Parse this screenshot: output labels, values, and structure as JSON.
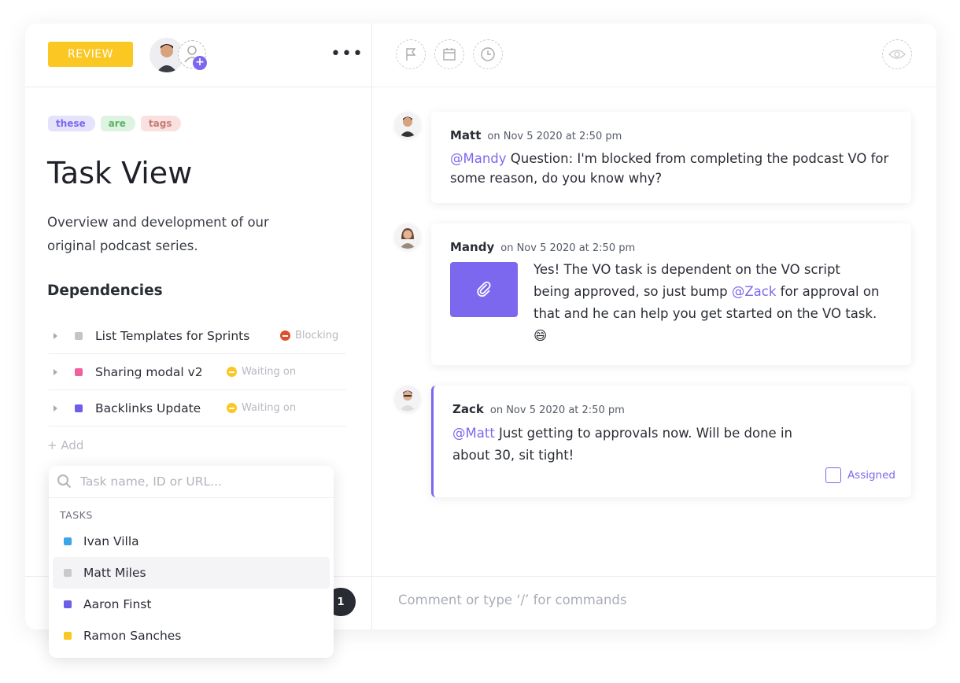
{
  "header": {
    "status": "REVIEW",
    "more_icon": "more-horizontal-icon",
    "toolbar_icons": [
      "flag-icon",
      "calendar-icon",
      "clock-icon"
    ],
    "watch_icon": "eye-icon"
  },
  "tags": [
    {
      "label": "these",
      "bg": "#e5e3fb",
      "fg": "#7b68ee"
    },
    {
      "label": "are",
      "bg": "#dff3e2",
      "fg": "#5db168"
    },
    {
      "label": "tags",
      "bg": "#f9e1df",
      "fg": "#c97a75"
    }
  ],
  "task": {
    "title": "Task View",
    "description": "Overview and development of our original podcast series."
  },
  "dependencies": {
    "heading": "Dependencies",
    "items": [
      {
        "name": "List Templates for Sprints",
        "color": "#c4c4c4",
        "status": "Blocking",
        "status_color": "#e04f2b"
      },
      {
        "name": "Sharing modal v2",
        "color": "#f0609e",
        "status": "Waiting on",
        "status_color": "#fbc723"
      },
      {
        "name": "Backlinks Update",
        "color": "#6e5ee8",
        "status": "Waiting on",
        "status_color": "#fbc723"
      }
    ],
    "add_label": "+ Add"
  },
  "dropdown": {
    "placeholder": "Task name, ID or URL...",
    "heading": "TASKS",
    "items": [
      {
        "name": "Ivan Villa",
        "color": "#3aa6e8"
      },
      {
        "name": "Matt Miles",
        "color": "#c9c9c9"
      },
      {
        "name": "Aaron Finst",
        "color": "#6e5ee8"
      },
      {
        "name": "Ramon Sanches",
        "color": "#fbc723"
      }
    ]
  },
  "badge_count": "1",
  "comments": [
    {
      "author": "Matt",
      "time": "on Nov 5 2020 at 2:50 pm",
      "mention": "@Mandy",
      "text": " Question: I'm blocked from completing the podcast VO for some reason, do you know why?"
    },
    {
      "author": "Mandy",
      "time": "on Nov 5 2020 at 2:50 pm",
      "text_before": "Yes! The VO task is dependent on the VO script being approved, so just bump ",
      "mention": "@Zack",
      "text_after": " for approval on that and he can help you get started on the VO task. 😄",
      "attachment_icon": "paperclip-icon"
    },
    {
      "author": "Zack",
      "time": "on Nov 5 2020 at 2:50 pm",
      "mention": "@Matt",
      "text": " Just getting to approvals now. Will be done in about 30, sit tight!",
      "assigned_label": "Assigned",
      "assigned": false
    }
  ],
  "comment_input": {
    "placeholder": "Comment or type ‘/’ for commands"
  },
  "colors": {
    "accent": "#7b68ee",
    "review": "#fbc723"
  }
}
